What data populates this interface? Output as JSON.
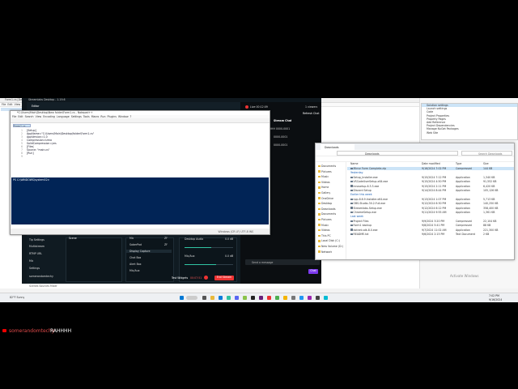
{
  "editor_bg": {
    "title": "Form1.cs [Design]",
    "menu": [
      "File",
      "Edit",
      "View",
      "Git",
      "Project",
      "Build",
      "Debug",
      "Test",
      "Analyze",
      "Tools",
      "Extensions",
      "Window",
      "Help"
    ]
  },
  "right_app": {
    "menu_items": [
      "Solution settings",
      "Launch settings",
      "Code",
      "Project Properties",
      "Property Pages",
      "Add Reference",
      "Project Dependencies",
      "Manage NuGet Packages",
      "Web Site"
    ],
    "activate": "Activate Windows"
  },
  "streamlabs": {
    "title": "Streamlabs Desktop - 1.19.6",
    "editor_label": "Editor",
    "chat_title": "Stream Chat",
    "refresh_chat": "Refresh Chat",
    "live_label": "Live 00:12:09",
    "viewers": "1 viewers",
    "chat_lines": [
      "RAHHHH 0000-0001",
      "0000-0001",
      "0000-0001"
    ],
    "chat_input_placeholder": "Send a message",
    "chat_send": "Chat",
    "side_items": [
      "Tip Settings",
      "Multistream",
      "RTMP URL",
      "Mic",
      "Settings",
      "somerandomtechy"
    ],
    "scenes": [
      "Scene"
    ],
    "sources": [
      {
        "name": "Mic",
        "kind": "ZF"
      },
      {
        "name": "SoberPad",
        "kind": "ZF"
      },
      {
        "name": "Display Capture",
        "kind": ""
      },
      {
        "name": "Chat Box",
        "kind": ""
      },
      {
        "name": "Alert Box",
        "kind": ""
      },
      {
        "name": "Mic/Aux",
        "kind": ""
      }
    ],
    "mixer": [
      {
        "name": "Desktop Audio",
        "value": "0.0 dB",
        "level": 0.55
      },
      {
        "name": "Mic/Aux",
        "value": "0.0 dB",
        "level": 0.65
      }
    ],
    "test_widgets": "Test Widgets",
    "timer": "00:07:51",
    "go_live": "End Stream",
    "bottom_tabs": [
      "Scenes",
      "Sources",
      "Mixer"
    ]
  },
  "notepad": {
    "title": "*C:\\Users\\Main\\Desktop\\New folder\\Form1.cs - Notepad++",
    "menu": [
      "File",
      "Edit",
      "Search",
      "View",
      "Encoding",
      "Language",
      "Settings",
      "Tools",
      "Macro",
      "Run",
      "Plugins",
      "Window",
      "?"
    ],
    "tab": "Form1.cs",
    "lines": [
      {
        "n": "1",
        "code": "[Setup]"
      },
      {
        "n": "2",
        "code": "AppName=\"C:\\Users\\Main\\Desktop\\folder\\Form1.cs\""
      },
      {
        "n": "3",
        "code": "AppVersion=1.0"
      },
      {
        "n": "4",
        "code": "Compression=lzma"
      },
      {
        "n": "5",
        "code": "SolidCompression=yes"
      },
      {
        "n": "6",
        "code": "[Files]"
      },
      {
        "n": "7",
        "code": "Source: \"main.cs\""
      },
      {
        "n": "8",
        "code": "[Run]"
      },
      {
        "n": "9",
        "code": ""
      }
    ],
    "console": "PS C:\\WINDOWS\\system32>",
    "status": "Windows (CR LF)   UTF-8   INS"
  },
  "explorer": {
    "tab": "Downloads",
    "address": "Downloads",
    "search": "Search Downloads",
    "nav": [
      "Documents",
      "Pictures",
      "Music",
      "Videos",
      "Home",
      "Gallery",
      "OneDrive",
      "Desktop",
      "Downloads",
      "Documents",
      "Pictures",
      "Music",
      "Videos",
      "This PC",
      "Local Disk (C:)",
      "New Volume (D:)",
      "Network"
    ],
    "columns": [
      "Name",
      "Date modified",
      "Type",
      "Size"
    ],
    "groups": [
      "Today",
      "Yesterday",
      "Earlier this week",
      "Last week"
    ],
    "files": [
      {
        "name": "Mirror Form Complete.zip",
        "date": "9/16/2024 7:02 PM",
        "type": "Compressed",
        "size": "144 KB",
        "sel": true
      },
      {
        "name": "Yesterday",
        "date": "",
        "type": "",
        "size": "",
        "group": true
      },
      {
        "name": "Setup_Installer.exe",
        "date": "9/15/2024 7:12 PM",
        "type": "Application",
        "size": "1,340 KB"
      },
      {
        "name": "VSCodeUserSetup-x64.exe",
        "date": "9/15/2024 4:50 PM",
        "type": "Application",
        "size": "91,552 KB"
      },
      {
        "name": "innosetup-6.3.3.exe",
        "date": "9/15/2024 2:11 PM",
        "type": "Application",
        "size": "6,420 KB"
      },
      {
        "name": "Discord Setup",
        "date": "9/14/2024 8:44 PM",
        "type": "Application",
        "size": "105,126 KB"
      },
      {
        "name": "Earlier this week",
        "date": "",
        "type": "",
        "size": "",
        "group": true
      },
      {
        "name": "npp.8.6.9.Installer.x64.exe",
        "date": "9/13/2024 1:07 PM",
        "type": "Application",
        "size": "5,713 KB"
      },
      {
        "name": "OBS-Studio-30.2-Full.exe",
        "date": "9/12/2024 6:30 PM",
        "type": "Application",
        "size": "140,250 KB"
      },
      {
        "name": "Streamlabs-Setup.exe",
        "date": "9/12/2024 6:12 PM",
        "type": "Application",
        "size": "358,400 KB"
      },
      {
        "name": "ChromeSetup.exe",
        "date": "9/11/2024 9:55 AM",
        "type": "Application",
        "size": "1,361 KB"
      },
      {
        "name": "Last week",
        "date": "",
        "type": "",
        "size": "",
        "group": true
      },
      {
        "name": "Project Files",
        "date": "9/9/2024 3:20 PM",
        "type": "Compressed",
        "size": "22,104 KB"
      },
      {
        "name": "Form1 backup",
        "date": "9/8/2024 5:41 PM",
        "type": "Compressed",
        "size": "88 KB"
      },
      {
        "name": "dotnet-sdk-8.0.exe",
        "date": "9/7/2024 11:02 AM",
        "type": "Application",
        "size": "221,300 KB"
      },
      {
        "name": "README.txt",
        "date": "9/6/2024 2:15 PM",
        "type": "Text Document",
        "size": "2 KB"
      }
    ],
    "status": "32 items   1 item selected"
  },
  "taskbar": {
    "weather": "82°F Sunny",
    "time": "7:02 PM",
    "date": "9/16/2024"
  },
  "overlay": {
    "user": "somerandomtechy",
    "message": "RAHHHH"
  },
  "colors": {
    "streamlabs_bg": "#17242d",
    "accent_red": "#e33333",
    "accent_teal": "#31c3a2",
    "chat_send": "#7c3aed",
    "console_blue": "#012456",
    "overlay_user": "#e04a4a"
  }
}
